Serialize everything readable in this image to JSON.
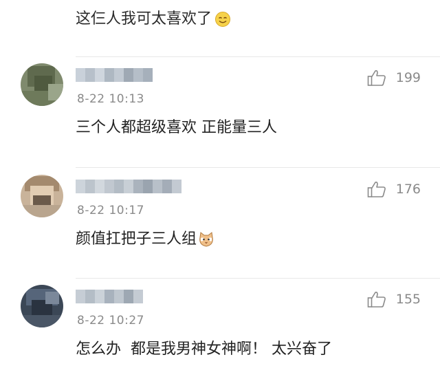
{
  "top_comment": {
    "text": "这仨人我可太喜欢了",
    "emoji_icon": "smile-emoji-icon"
  },
  "comments": [
    {
      "timestamp": "8-22 10:13",
      "text": "三个人都超级喜欢 正能量三人",
      "likes": "199"
    },
    {
      "timestamp": "8-22 10:17",
      "text": "颜值扛把子三人组",
      "emoji_icon": "cat-emoji-icon",
      "likes": "176"
    },
    {
      "timestamp": "8-22 10:27",
      "text": "怎么办  都是我男神女神啊！ 太兴奋了",
      "likes": "155"
    }
  ],
  "colors": {
    "meta_text": "#8a8a8a",
    "divider": "#e8e8e8",
    "body_text": "#222222"
  }
}
